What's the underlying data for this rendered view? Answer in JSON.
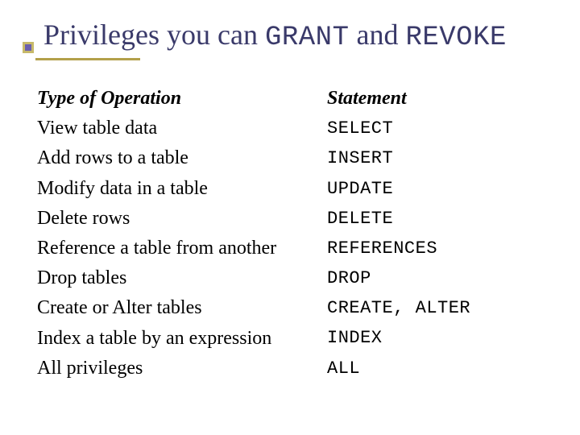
{
  "title": {
    "pre": "Privileges you can ",
    "kw1": "GRANT",
    "mid": " and ",
    "kw2": "REVOKE"
  },
  "headers": {
    "operation": "Type of Operation",
    "statement": "Statement"
  },
  "rows": [
    {
      "op": "View table data",
      "stmt": "SELECT"
    },
    {
      "op": "Add rows to a table",
      "stmt": "INSERT"
    },
    {
      "op": "Modify data in a table",
      "stmt": "UPDATE"
    },
    {
      "op": "Delete rows",
      "stmt": "DELETE"
    },
    {
      "op": "Reference a table from another",
      "stmt": "REFERENCES"
    },
    {
      "op": "Drop tables",
      "stmt": "DROP"
    },
    {
      "op": "Create or Alter tables",
      "stmt": "CREATE, ALTER"
    },
    {
      "op": "Index a table by an expression",
      "stmt": "INDEX"
    },
    {
      "op": "All privileges",
      "stmt": "ALL"
    }
  ]
}
